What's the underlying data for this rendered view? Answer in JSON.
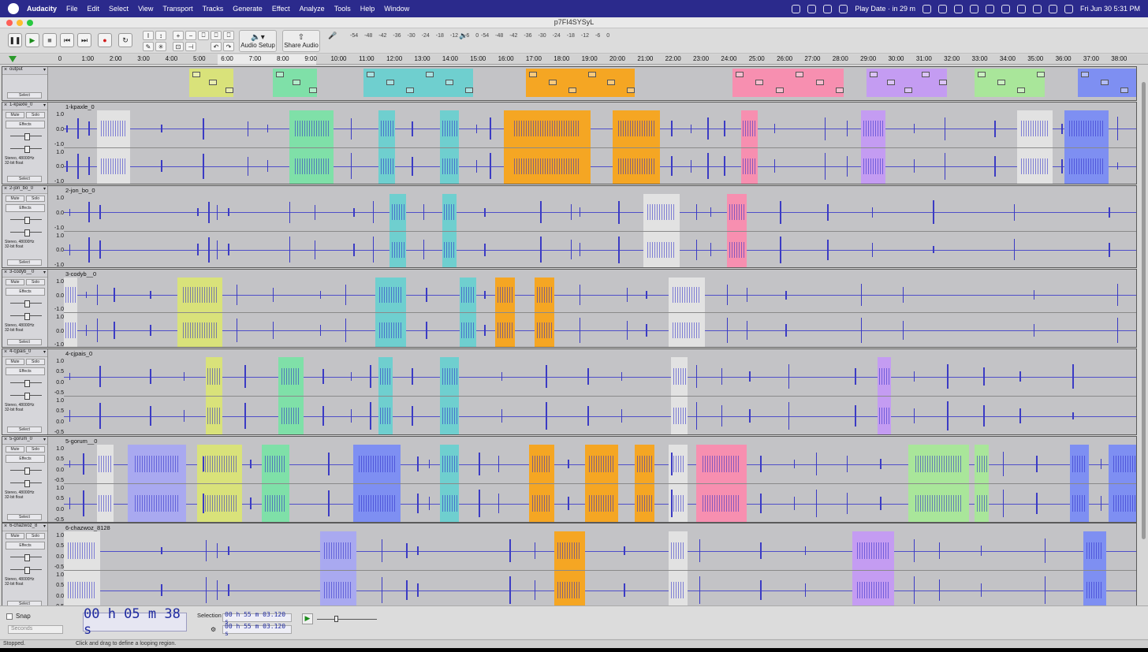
{
  "menubar": {
    "app_name": "Audacity",
    "items": [
      "File",
      "Edit",
      "Select",
      "View",
      "Transport",
      "Tracks",
      "Generate",
      "Effect",
      "Analyze",
      "Tools",
      "Help",
      "Window"
    ],
    "status_text": "Play Date · in 29 m",
    "clock": "Fri Jun 30  5:31 PM"
  },
  "window": {
    "title": "p7FI4SYSyL"
  },
  "toolbar": {
    "pause_icon": "pause-icon",
    "play_icon": "play-icon",
    "stop_icon": "stop-icon",
    "skip_start_icon": "skip-to-start-icon",
    "skip_end_icon": "skip-to-end-icon",
    "record_icon": "record-icon",
    "loop_icon": "loop-icon",
    "audio_setup_label": "Audio Setup",
    "share_audio_label": "Share Audio",
    "record_meter_ticks": [
      "-54",
      "-48",
      "-42",
      "-36",
      "-30",
      "-24",
      "-18",
      "-12",
      "-6",
      "0"
    ],
    "play_meter_ticks": [
      "-54",
      "-48",
      "-42",
      "-36",
      "-30",
      "-24",
      "-18",
      "-12",
      "-6",
      "0"
    ],
    "meter_lr": "L\nR"
  },
  "ruler": {
    "ticks": [
      "0",
      "1:00",
      "2:00",
      "3:00",
      "4:00",
      "5:00",
      "6:00",
      "7:00",
      "8:00",
      "9:00",
      "10:00",
      "11:00",
      "12:00",
      "13:00",
      "14:00",
      "15:00",
      "16:00",
      "17:00",
      "18:00",
      "19:00",
      "20:00",
      "21:00",
      "22:00",
      "23:00",
      "24:00",
      "25:00",
      "26:00",
      "27:00",
      "28:00",
      "29:00",
      "30:00",
      "31:00",
      "32:00",
      "33:00",
      "34:00",
      "35:00",
      "36:00",
      "37:00",
      "38:00"
    ]
  },
  "colors": {
    "yellow": "#d9e27a",
    "green": "#7fe0a8",
    "teal": "#6fcfcf",
    "orange": "#f5a623",
    "pink": "#f78fb0",
    "purple": "#c49cf2",
    "lightgreen": "#a9e69a",
    "blue": "#7e8ff2",
    "grey": "#e2e2e2",
    "lavender": "#a9a9f0"
  },
  "tracks": [
    {
      "panel_name": "output",
      "select_label": "Select"
    },
    {
      "panel_name": "1-kpaxle_0",
      "clip_name": "1-kpaxle_0",
      "mute": "Mute",
      "solo": "Solo",
      "effects": "Effects",
      "info": "Stereo, 48000Hz\n32-bit float",
      "select": "Select",
      "scale": [
        "1.0",
        "0.0",
        "-1.0",
        "1.0",
        "0.0",
        "-1.0"
      ]
    },
    {
      "panel_name": "2-jon_bo_0",
      "clip_name": "2-jon_bo_0",
      "mute": "Mute",
      "solo": "Solo",
      "effects": "Effects",
      "info": "Stereo, 48000Hz\n32-bit float",
      "select": "Select",
      "scale": [
        "1.0",
        "0.0",
        "-1.0",
        "1.0",
        "0.0",
        "-1.0"
      ]
    },
    {
      "panel_name": "3-codyb__0",
      "clip_name": "3-codyb__0",
      "mute": "Mute",
      "solo": "Solo",
      "effects": "Effects",
      "info": "Stereo, 48000Hz\n32-bit float",
      "select": "Select",
      "scale": [
        "1.0",
        "0.0",
        "-1.0",
        "1.0",
        "0.0",
        "-1.0"
      ]
    },
    {
      "panel_name": "4-cjpais_0",
      "clip_name": "4-cjpais_0",
      "mute": "Mute",
      "solo": "Solo",
      "effects": "Effects",
      "info": "Stereo, 48000Hz\n32-bit float",
      "select": "Select",
      "scale": [
        "1.0",
        "0.5",
        "0.0",
        "-0.5",
        "1.0",
        "0.5",
        "0.0",
        "-0.5"
      ]
    },
    {
      "panel_name": "5-gorum_0",
      "clip_name": "5-gorum__0",
      "mute": "Mute",
      "solo": "Solo",
      "effects": "Effects",
      "info": "Stereo, 48000Hz\n32-bit float",
      "select": "Select",
      "scale": [
        "1.0",
        "0.5",
        "0.0",
        "-0.5",
        "1.0",
        "0.5",
        "0.0",
        "-0.5"
      ]
    },
    {
      "panel_name": "6-chazwoz_8",
      "clip_name": "6-chazwoz_8128",
      "mute": "Mute",
      "solo": "Solo",
      "effects": "Effects",
      "info": "Stereo, 48000Hz\n32-bit float",
      "select": "Select",
      "scale": [
        "1.0",
        "0.5",
        "0.0",
        "-0.5",
        "1.0",
        "0.5",
        "0.0",
        "-0.5"
      ]
    }
  ],
  "selection_bar": {
    "snap_label": "Snap",
    "snap_unit": "Seconds",
    "time": "00 h 05 m 38 s",
    "selection_label": "Selection",
    "sel_start": "00 h 55 m 03.120 s",
    "sel_end": "00 h 55 m 03.120 s"
  },
  "status": {
    "left": "Stopped.",
    "hint": "Click and drag to define a looping region."
  }
}
